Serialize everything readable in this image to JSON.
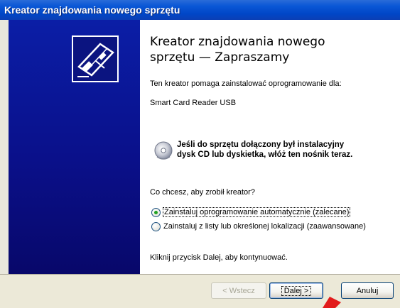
{
  "window": {
    "title": "Kreator znajdowania nowego sprzętu"
  },
  "content": {
    "heading_line1": "Kreator znajdowania nowego",
    "heading_line2": "sprzętu — Zapraszamy",
    "intro": "Ten kreator pomaga zainstalować oprogramowanie dla:",
    "device_name": "Smart Card Reader USB",
    "cd_line1": "Jeśli do sprzętu dołączony był instalacyjny",
    "cd_line2": "dysk CD lub dyskietka, włóż ten nośnik teraz.",
    "question": "Co chcesz, aby zrobił kreator?",
    "options": [
      {
        "label": "Zainstaluj oprogramowanie automatycznie (zalecane)",
        "selected": true
      },
      {
        "label": "Zainstaluj z listy lub określonej lokalizacji (zaawansowane)",
        "selected": false
      }
    ],
    "continue_hint": "Kliknij przycisk Dalej, aby kontynuować."
  },
  "buttons": {
    "back": "< Wstecz",
    "next": "Dalej >",
    "cancel": "Anuluj"
  },
  "colors": {
    "titlebar": "#0a57d6",
    "left_panel": "#0a108a",
    "footer": "#ece9d8",
    "annotation_arrow": "#e21b1b"
  },
  "icons": {
    "wizard": "hardware-card-icon",
    "cd": "cd-disc-icon",
    "annotation": "red-arrow-icon"
  }
}
